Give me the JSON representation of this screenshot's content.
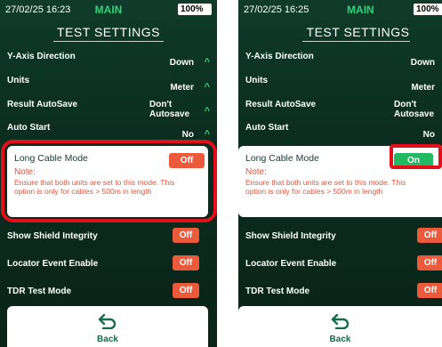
{
  "screens": [
    {
      "status": {
        "time": "27/02/25 16:23",
        "mode": "MAIN",
        "battery": "100%"
      },
      "title": "TEST SETTINGS",
      "settings": [
        {
          "label": "Y-Axis Direction",
          "value": "Down"
        },
        {
          "label": "Units",
          "value": "Meter"
        },
        {
          "label": "Result AutoSave",
          "value": "Don't Autosave"
        },
        {
          "label": "Auto Start",
          "value": "No"
        }
      ],
      "long_cable": {
        "label": "Long Cable Mode",
        "state": "Off",
        "note_heading": "Note:",
        "note_text": "Ensure that both units are set to this mode. This option is only for cables > 500m in length"
      },
      "switches": [
        {
          "label": "Show Shield Integrity",
          "state": "Off"
        },
        {
          "label": "Locator Event Enable",
          "state": "Off"
        },
        {
          "label": "TDR Test Mode",
          "state": "Off"
        }
      ],
      "back_label": "Back"
    },
    {
      "status": {
        "time": "27/02/25 16:25",
        "mode": "MAIN",
        "battery": "100%"
      },
      "title": "TEST SETTINGS",
      "settings": [
        {
          "label": "Y-Axis Direction",
          "value": "Down"
        },
        {
          "label": "Units",
          "value": "Meter"
        },
        {
          "label": "Result AutoSave",
          "value": "Don't Autosave"
        },
        {
          "label": "Auto Start",
          "value": "No"
        }
      ],
      "long_cable": {
        "label": "Long Cable Mode",
        "state": "On",
        "note_heading": "Note:",
        "note_text": "Ensure that both units are set to this mode. This option is only for cables > 500m in length"
      },
      "switches": [
        {
          "label": "Show Shield Integrity",
          "state": "Off"
        },
        {
          "label": "Locator Event Enable",
          "state": "Off"
        },
        {
          "label": "TDR Test Mode",
          "state": "Off"
        }
      ],
      "back_label": "Back"
    }
  ],
  "colors": {
    "accent_green": "#2fd27a",
    "toggle_off": "#ec5a3c",
    "toggle_on": "#23b862",
    "highlight": "#e3101c",
    "background": "#0e3a2a"
  }
}
